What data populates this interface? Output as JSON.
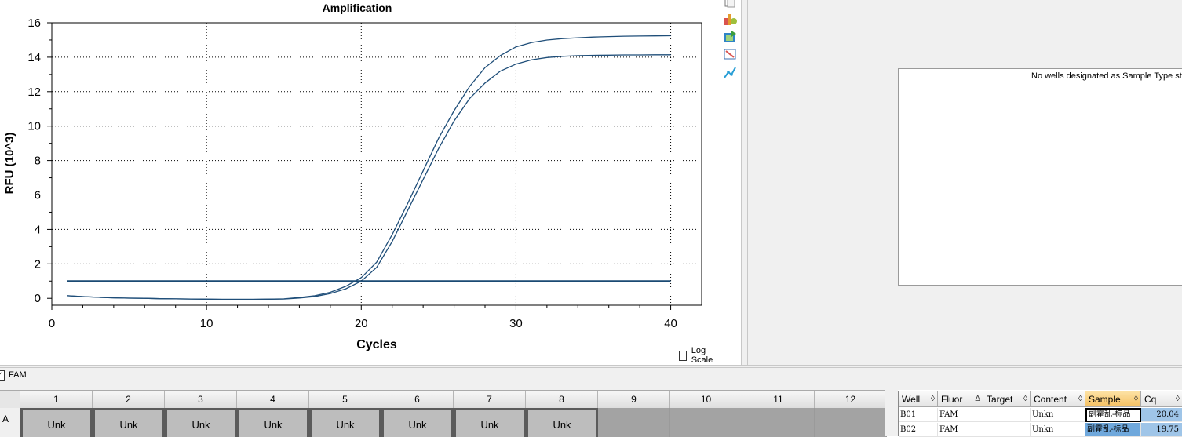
{
  "chart_data": {
    "type": "line",
    "title": "Amplification",
    "xlabel": "Cycles",
    "ylabel": "RFU (10^3)",
    "xlim": [
      0,
      42
    ],
    "ylim": [
      -0.4,
      16
    ],
    "xticks": [
      0,
      10,
      20,
      30,
      40
    ],
    "yticks": [
      0,
      2,
      4,
      6,
      8,
      10,
      12,
      14,
      16
    ],
    "grid": true,
    "series": [
      {
        "x": [
          1,
          2,
          3,
          4,
          5,
          6,
          7,
          8,
          9,
          10,
          11,
          12,
          13,
          14,
          15,
          16,
          17,
          18,
          19,
          20,
          21,
          22,
          23,
          24,
          25,
          26,
          27,
          28,
          29,
          30,
          31,
          32,
          33,
          34,
          35,
          36,
          37,
          38,
          39,
          40
        ],
        "y": [
          0.15,
          0.1,
          0.06,
          0.03,
          0.01,
          0,
          -0.02,
          -0.03,
          -0.04,
          -0.05,
          -0.06,
          -0.06,
          -0.06,
          -0.05,
          -0.03,
          0.05,
          0.15,
          0.35,
          0.7,
          1.2,
          2.1,
          3.7,
          5.5,
          7.4,
          9.3,
          10.9,
          12.3,
          13.4,
          14.1,
          14.6,
          14.85,
          15.0,
          15.08,
          15.13,
          15.17,
          15.2,
          15.22,
          15.23,
          15.24,
          15.25
        ]
      },
      {
        "x": [
          1,
          2,
          3,
          4,
          5,
          6,
          7,
          8,
          9,
          10,
          11,
          12,
          13,
          14,
          15,
          16,
          17,
          18,
          19,
          20,
          21,
          22,
          23,
          24,
          25,
          26,
          27,
          28,
          29,
          30,
          31,
          32,
          33,
          34,
          35,
          36,
          37,
          38,
          39,
          40
        ],
        "y": [
          0.15,
          0.1,
          0.06,
          0.03,
          0.01,
          0,
          -0.02,
          -0.03,
          -0.04,
          -0.05,
          -0.06,
          -0.06,
          -0.06,
          -0.05,
          -0.04,
          0.02,
          0.1,
          0.28,
          0.55,
          1.0,
          1.8,
          3.3,
          5.1,
          6.9,
          8.7,
          10.3,
          11.6,
          12.5,
          13.2,
          13.6,
          13.85,
          13.98,
          14.05,
          14.09,
          14.11,
          14.12,
          14.13,
          14.13,
          14.14,
          14.14
        ]
      }
    ],
    "threshold": 1.0,
    "colors": {
      "line": "#1f4e79",
      "threshold": "#1a4a73",
      "grid": "#000000"
    }
  },
  "log_scale_label": "Log Scale",
  "std_curve_message": "No wells designated as Sample Type standard",
  "fluor_label": "FAM",
  "toolbar_icons": [
    "copy-icon",
    "chart-settings-icon",
    "export-chart-icon",
    "zoom-chart-icon",
    "plot-line-icon"
  ],
  "plate": {
    "columns": [
      "1",
      "2",
      "3",
      "4",
      "5",
      "6",
      "7",
      "8",
      "9",
      "10",
      "11",
      "12"
    ],
    "row_label": "A",
    "wells": [
      "Unk",
      "Unk",
      "Unk",
      "Unk",
      "Unk",
      "Unk",
      "Unk",
      "Unk",
      "",
      "",
      "",
      ""
    ]
  },
  "table": {
    "headers": [
      "Well",
      "Fluor",
      "Target",
      "Content",
      "Sample",
      "Cq"
    ],
    "sort_indicators": [
      "◊",
      "Δ",
      "◊",
      "◊",
      "◊",
      "◊"
    ],
    "rows": [
      {
        "well": "B01",
        "fluor": "FAM",
        "target": "",
        "content": "Unkn",
        "sample": "副霍乱-标品",
        "cq": "20.04"
      },
      {
        "well": "B02",
        "fluor": "FAM",
        "target": "",
        "content": "Unkn",
        "sample": "副霍乱-标品",
        "cq": "19.75"
      }
    ]
  }
}
